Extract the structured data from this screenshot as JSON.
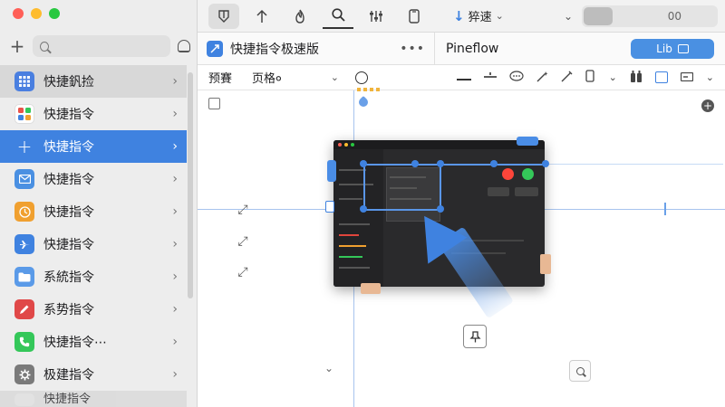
{
  "sidebar": {
    "search": {
      "placeholder": ""
    },
    "items": [
      {
        "label": "快捷釩捡",
        "icon": "grid-icon",
        "color": "#4a7fe0"
      },
      {
        "label": "快捷指令",
        "icon": "apps-icon",
        "color": "#ffffff"
      },
      {
        "label": "快捷指令",
        "icon": "plus-icon",
        "color": "#3f82e0"
      },
      {
        "label": "快捷指令",
        "icon": "mail-icon",
        "color": "#4a90e2"
      },
      {
        "label": "快捷指令",
        "icon": "clock-icon",
        "color": "#f0a030"
      },
      {
        "label": "快捷指令",
        "icon": "plane-icon",
        "color": "#3f82e0"
      },
      {
        "label": "系統指令",
        "icon": "folder-icon",
        "color": "#5a9ae8"
      },
      {
        "label": "系势指令",
        "icon": "pencil-icon",
        "color": "#e04848"
      },
      {
        "label": "快捷指令⋯",
        "icon": "phone-icon",
        "color": "#34c759"
      },
      {
        "label": "极建指令",
        "icon": "gear-icon",
        "color": "#7a7a7a"
      },
      {
        "label": "快捷指令",
        "icon": "doc-icon",
        "color": "#e0e0e0"
      }
    ]
  },
  "toolbar": {
    "speed_label": "猝速",
    "toggle_value": "00"
  },
  "header": {
    "doc_title": "快捷指令极速版",
    "more": "•••",
    "flow_title": "Pineflow",
    "lib_label": "Lib"
  },
  "subbar": {
    "preset_label": "预賽",
    "format_label": "页格०"
  },
  "colors": {
    "accent": "#3f82e0",
    "sidebar_bg": "#ededed",
    "selected_bg": "#3f82e0"
  }
}
